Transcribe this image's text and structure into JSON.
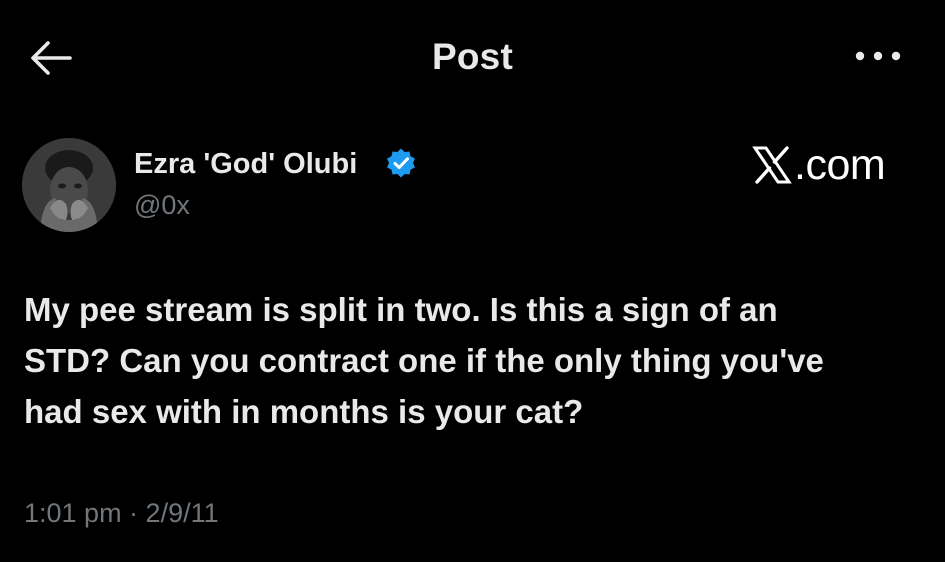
{
  "header": {
    "title": "Post",
    "back_icon": "arrow-left-icon",
    "more_icon": "more-horizontal-icon"
  },
  "author": {
    "display_name": "Ezra 'God' Olubi",
    "handle": "@0x",
    "verified": true,
    "verified_color": "#1d9bf0",
    "avatar_icon": "avatar-photo"
  },
  "watermark": {
    "text": ".com",
    "logo_icon": "x-logo-icon"
  },
  "tweet": {
    "lines": [
      "My pee stream is split in two. Is this a sign of an",
      "STD? Can you contract one if the only thing you've",
      "had sex with in months is your cat?"
    ]
  },
  "meta": {
    "timestamp": "1:01 pm · 2/9/11"
  },
  "colors": {
    "background": "#000000",
    "primary_text": "#e7e9ea",
    "secondary_text": "#71767b",
    "accent": "#1d9bf0"
  }
}
